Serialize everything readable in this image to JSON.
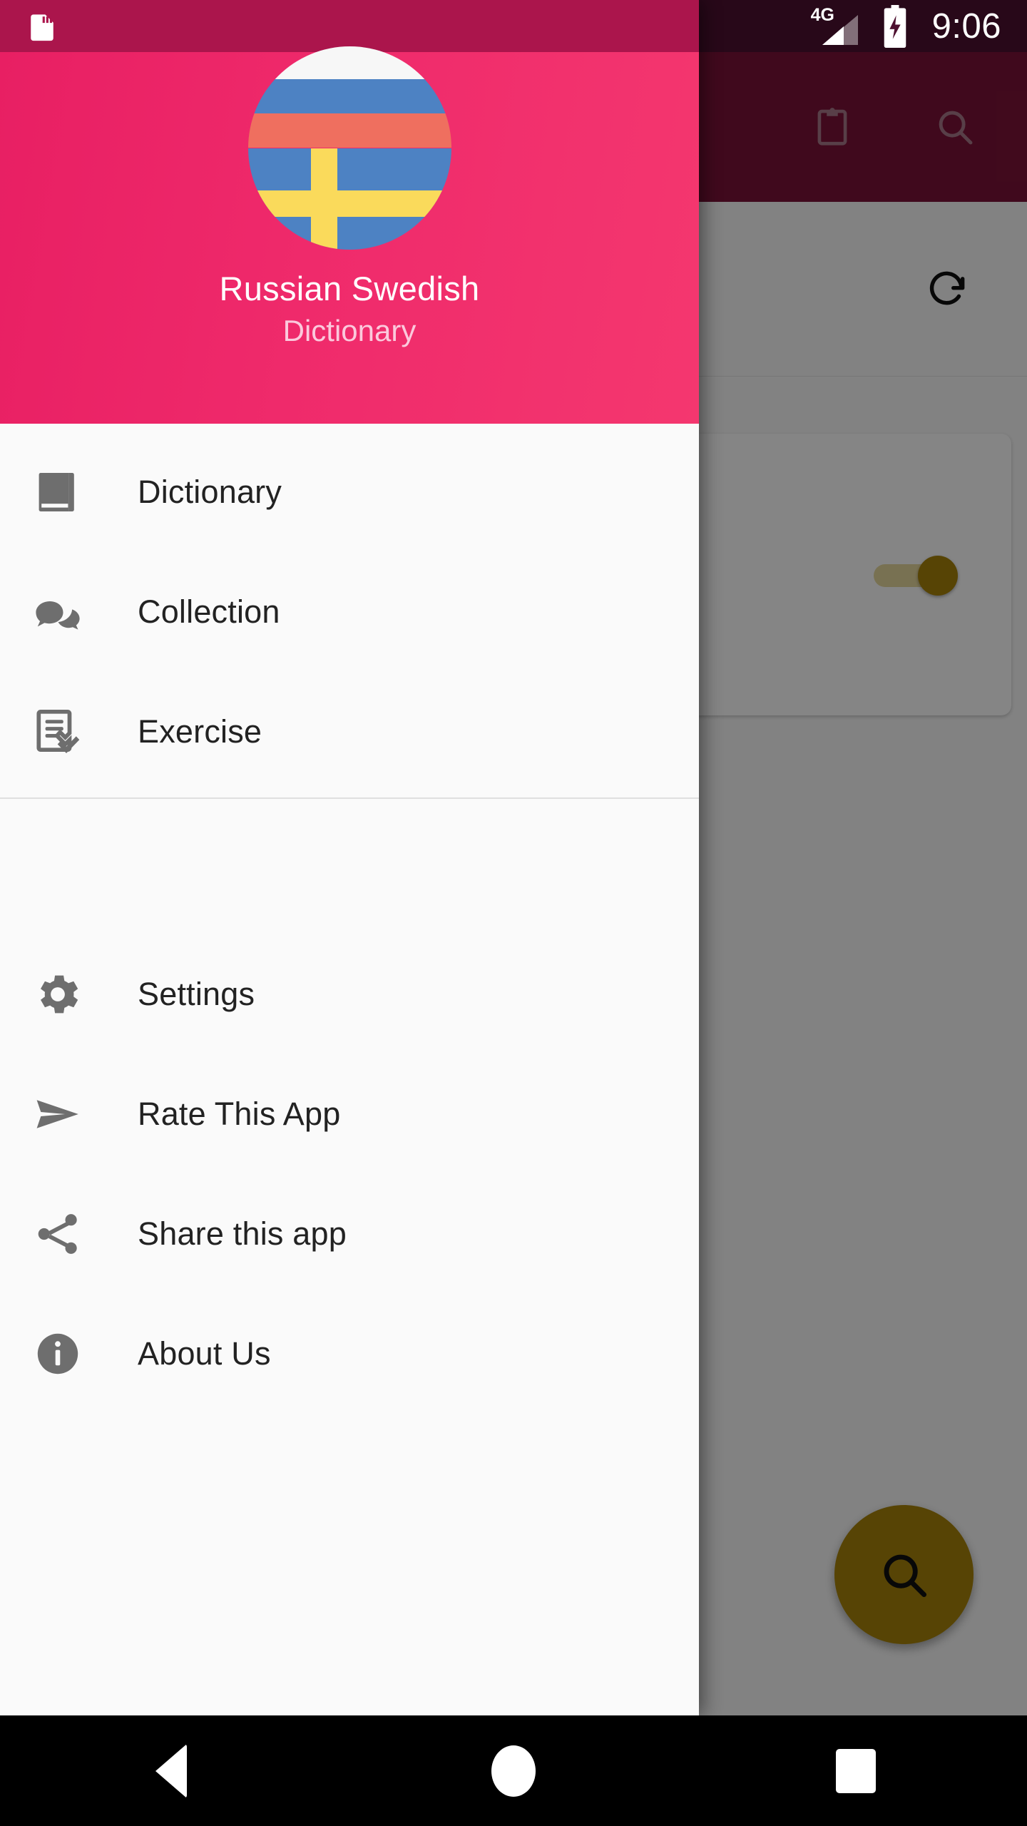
{
  "status_bar": {
    "left_icon": "sd-card-icon",
    "network_label": "4G",
    "signal_icon": "signal-bars-icon",
    "battery_icon": "battery-charging-icon",
    "clock": "9:06"
  },
  "app_background": {
    "toolbar": {
      "clipboard_icon_label": "clipboard-icon",
      "search_icon_label": "search-icon"
    },
    "content": {
      "refresh_icon_label": "refresh-icon",
      "toggle_label": "toggle-switch",
      "toggle_state": "on"
    },
    "fab": {
      "icon_label": "search-icon",
      "color": "#a8830a"
    }
  },
  "drawer": {
    "header": {
      "avatar_label": "russian-swedish-flag-avatar",
      "title": "Russian  Swedish",
      "subtitle": "Dictionary",
      "background_color": "#e81f63"
    },
    "groups": [
      {
        "items": [
          {
            "label": "Dictionary",
            "icon": "book-icon"
          },
          {
            "label": "Collection",
            "icon": "chat-bubbles-icon"
          },
          {
            "label": "Exercise",
            "icon": "checklist-icon"
          }
        ]
      },
      {
        "items": [
          {
            "label": "Settings",
            "icon": "gear-icon"
          },
          {
            "label": "Rate This App",
            "icon": "send-icon"
          },
          {
            "label": "Share this app",
            "icon": "share-icon"
          },
          {
            "label": "About Us",
            "icon": "info-circle-icon"
          }
        ]
      }
    ]
  },
  "navigation_bar": {
    "back_label": "Back",
    "home_label": "Home",
    "recents_label": "Recents"
  }
}
